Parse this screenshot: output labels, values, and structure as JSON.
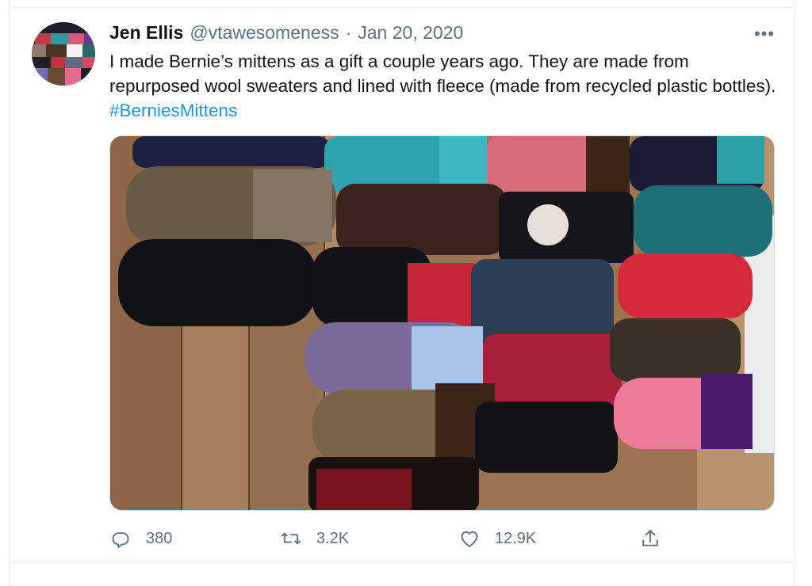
{
  "tweet": {
    "author_name": "Jen Ellis",
    "handle": "@vtawesomeness",
    "separator": "·",
    "date": "Jan 20, 2020",
    "more_label": "•••",
    "text": "I made Bernie’s mittens as a gift a couple years ago. They are made from repurposed wool sweaters and lined with fleece (made from recycled plastic bottles). ",
    "hashtag": "#BerniesMittens",
    "media_icon": "photo-of-mittens",
    "replies": "380",
    "retweets": "3.2K",
    "likes": "12.9K"
  },
  "colors": {
    "hashtag": "#1b95e0",
    "secondary_text": "#5b7083",
    "border": "#e6ecf0"
  },
  "icons": {
    "reply": "reply-icon",
    "retweet": "retweet-icon",
    "like": "heart-icon",
    "share": "share-icon"
  }
}
